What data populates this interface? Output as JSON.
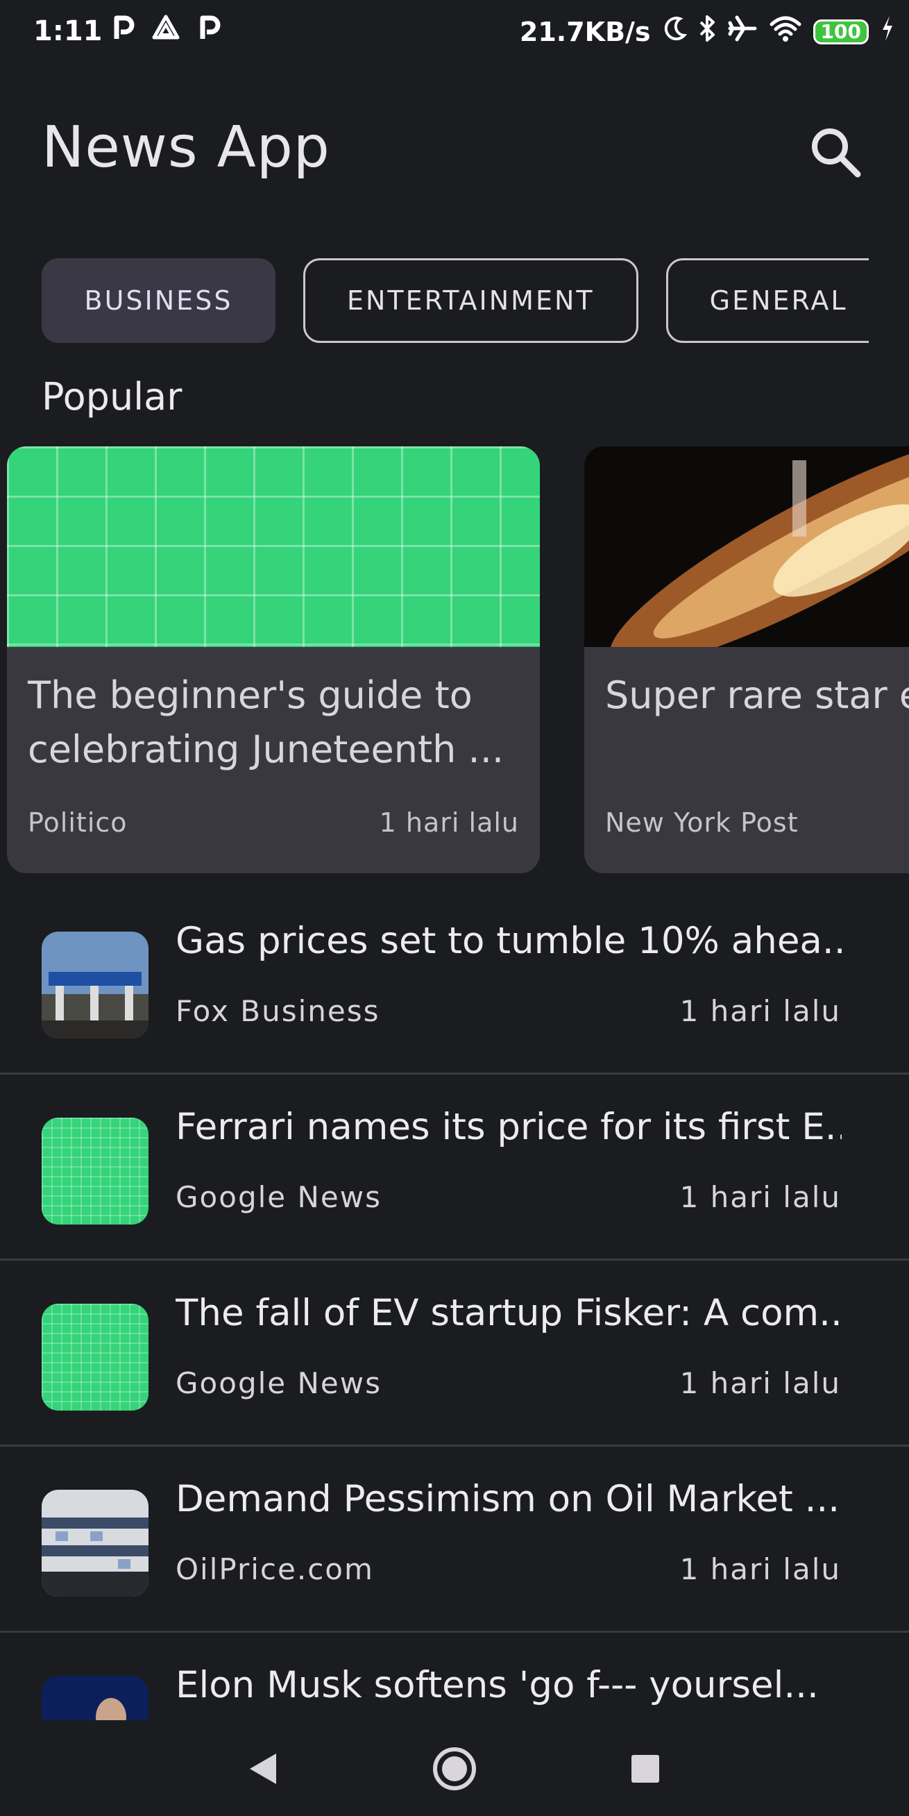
{
  "status_bar": {
    "time": "1:11",
    "net_speed": "21.7KB/s",
    "battery": "100",
    "left_icons": [
      "p-notification-icon",
      "drive-icon",
      "p-notification-icon"
    ],
    "right_icons": [
      "moon-icon",
      "bluetooth-icon",
      "airplane-icon",
      "wifi-icon",
      "battery-icon",
      "charging-icon"
    ]
  },
  "app_bar": {
    "title": "News App",
    "search_icon": "search-icon"
  },
  "categories": [
    {
      "label": "BUSINESS",
      "active": true
    },
    {
      "label": "ENTERTAINMENT",
      "active": false
    },
    {
      "label": "GENERAL",
      "active": false
    }
  ],
  "popular": {
    "heading": "Popular",
    "items": [
      {
        "title": "The beginner's guide to celebrating Juneteenth ...",
        "source": "Politico",
        "time": "1 hari lalu"
      },
      {
        "title": "Super rare star e will be visible fro",
        "source": "New York Post",
        "time": ""
      }
    ]
  },
  "articles": [
    {
      "title": "Gas prices set to tumble 10% ahea...",
      "source": "Fox Business",
      "time": "1 hari lalu"
    },
    {
      "title": "Ferrari names its price for its first E...",
      "source": "Google News",
      "time": "1 hari lalu"
    },
    {
      "title": "The fall of EV startup Fisker: A com...",
      "source": "Google News",
      "time": "1 hari lalu"
    },
    {
      "title": "Demand Pessimism on Oil Market ...",
      "source": "OilPrice.com",
      "time": "1 hari lalu"
    },
    {
      "title": "Elon Musk softens 'go f--- yoursel...",
      "source": "",
      "time": ""
    }
  ],
  "colors": {
    "background": "#1b1c1f",
    "card": "#39383f",
    "chip_active": "#3a3844",
    "placeholder_green": "#35d47a"
  }
}
